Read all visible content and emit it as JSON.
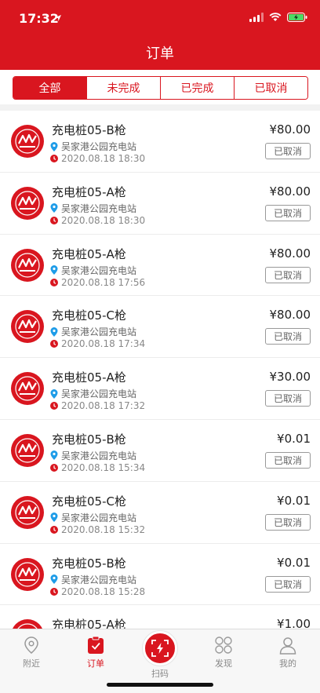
{
  "status_bar": {
    "time": "17:32"
  },
  "header": {
    "title": "订单"
  },
  "tabs": [
    {
      "label": "全部",
      "active": true
    },
    {
      "label": "未完成",
      "active": false
    },
    {
      "label": "已完成",
      "active": false
    },
    {
      "label": "已取消",
      "active": false
    }
  ],
  "orders": [
    {
      "title": "充电桩05-B枪",
      "station": "吴家港公园充电站",
      "time": "2020.08.18 18:30",
      "price": "¥80.00",
      "status": "已取消"
    },
    {
      "title": "充电桩05-A枪",
      "station": "吴家港公园充电站",
      "time": "2020.08.18 18:30",
      "price": "¥80.00",
      "status": "已取消"
    },
    {
      "title": "充电桩05-A枪",
      "station": "吴家港公园充电站",
      "time": "2020.08.18 17:56",
      "price": "¥80.00",
      "status": "已取消"
    },
    {
      "title": "充电桩05-C枪",
      "station": "吴家港公园充电站",
      "time": "2020.08.18 17:34",
      "price": "¥80.00",
      "status": "已取消"
    },
    {
      "title": "充电桩05-A枪",
      "station": "吴家港公园充电站",
      "time": "2020.08.18 17:32",
      "price": "¥30.00",
      "status": "已取消"
    },
    {
      "title": "充电桩05-B枪",
      "station": "吴家港公园充电站",
      "time": "2020.08.18 15:34",
      "price": "¥0.01",
      "status": "已取消"
    },
    {
      "title": "充电桩05-C枪",
      "station": "吴家港公园充电站",
      "time": "2020.08.18 15:32",
      "price": "¥0.01",
      "status": "已取消"
    },
    {
      "title": "充电桩05-B枪",
      "station": "吴家港公园充电站",
      "time": "2020.08.18 15:28",
      "price": "¥0.01",
      "status": "已取消"
    },
    {
      "title": "充电桩05-A枪",
      "station": "",
      "time": "",
      "price": "¥1.00",
      "status": ""
    }
  ],
  "bottom_nav": {
    "nearby": "附近",
    "orders": "订单",
    "scan": "扫码",
    "discover": "发现",
    "mine": "我的"
  },
  "colors": {
    "brand": "#d9161f",
    "battery": "#4cd964"
  }
}
